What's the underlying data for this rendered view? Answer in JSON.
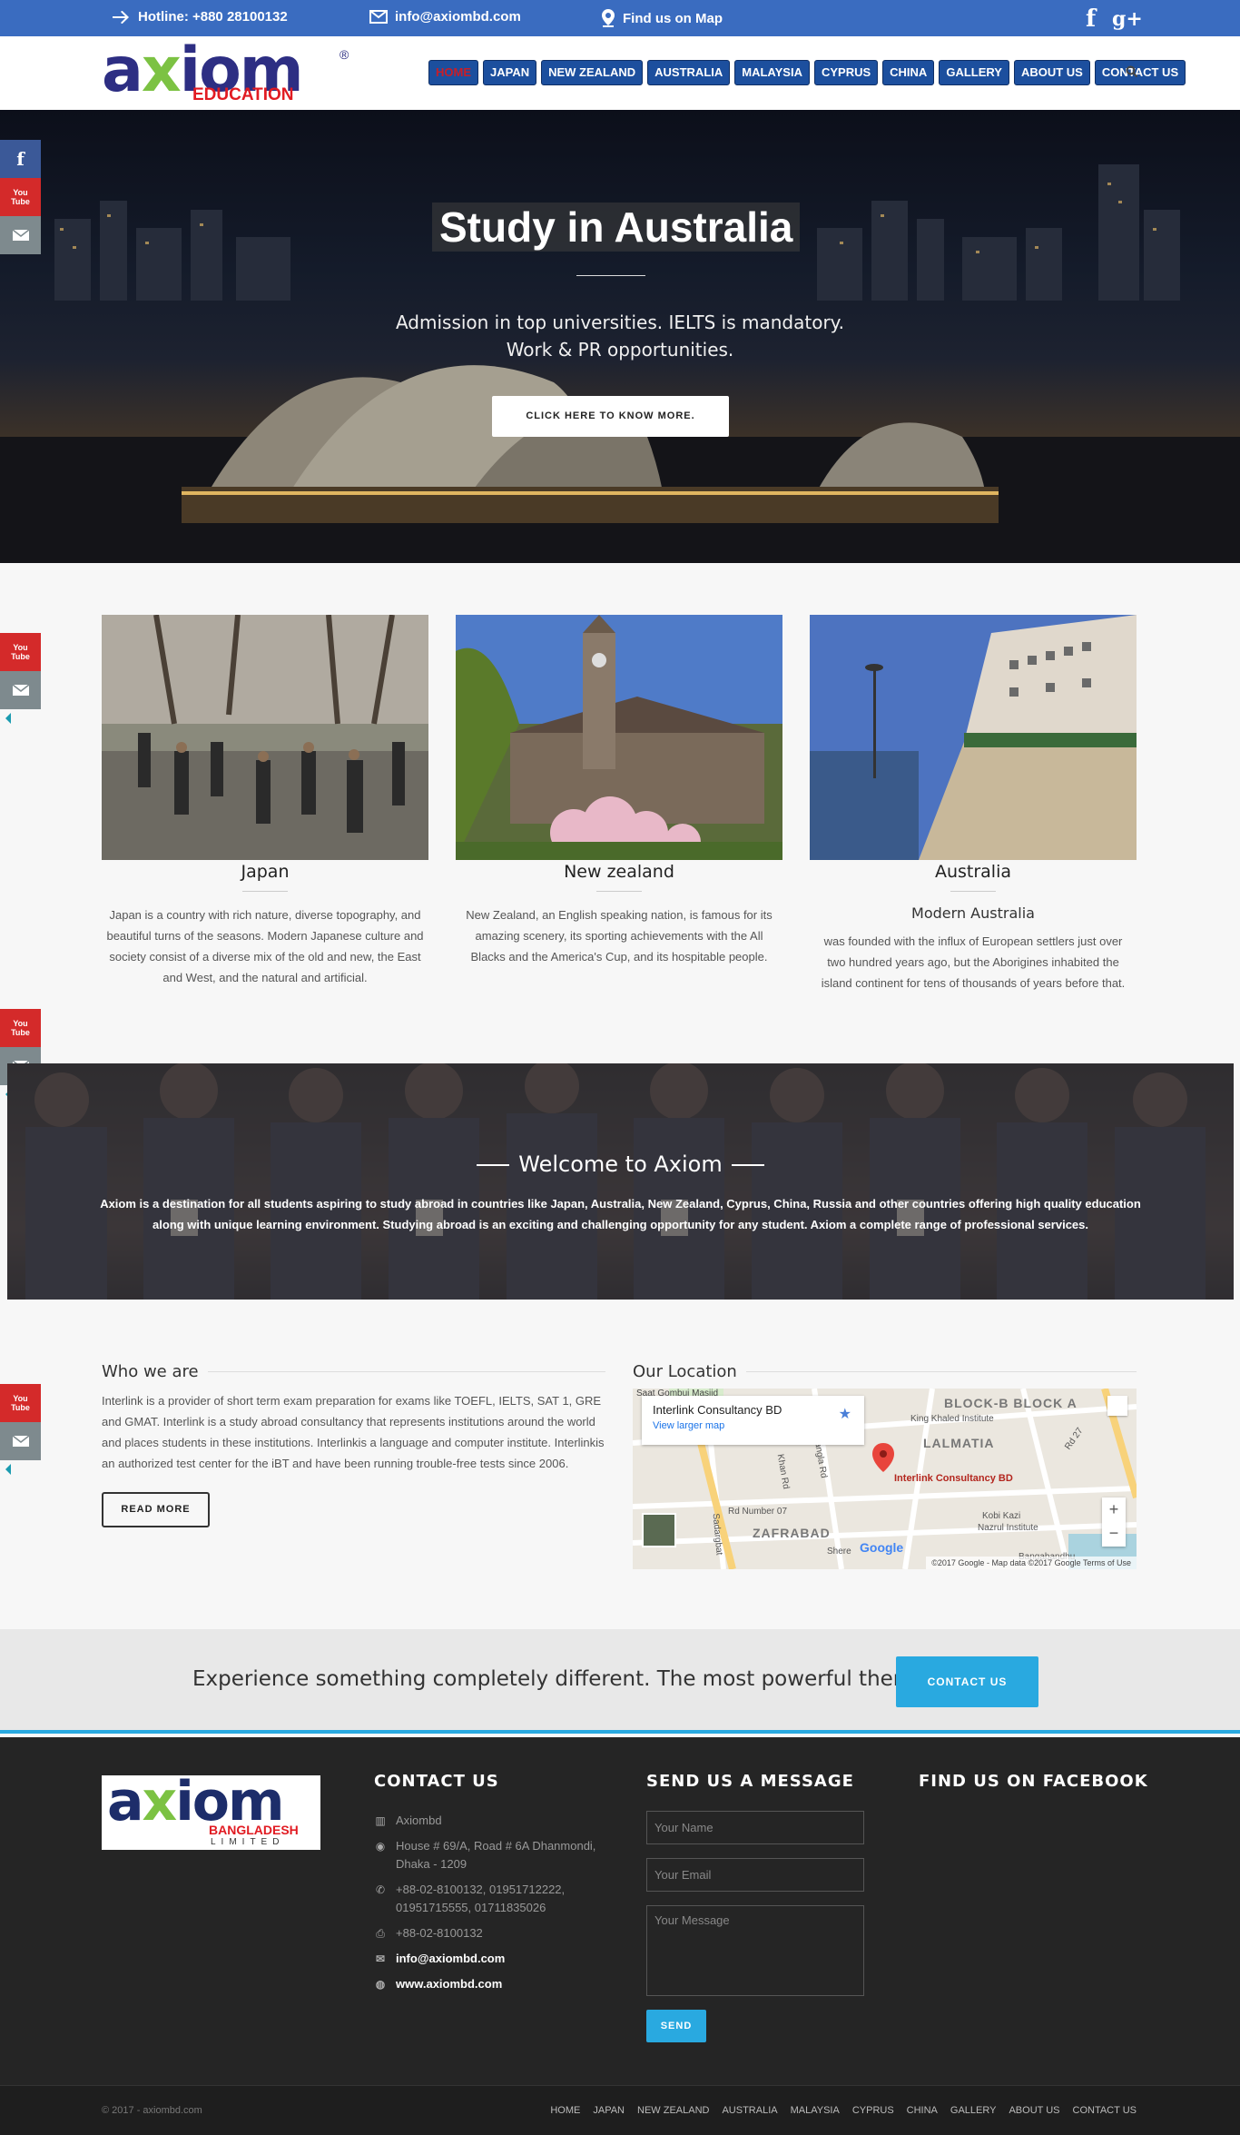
{
  "topbar": {
    "hotline": "Hotline: +880 28100132",
    "email": "info@axiombd.com",
    "map": "Find us on Map",
    "facebook_glyph": "f",
    "gplus_glyph": "g+"
  },
  "logo": {
    "ax1": "a",
    "x": "x",
    "ax2": "iom",
    "reg": "®",
    "education": "EDUCATION"
  },
  "nav": {
    "items": [
      "HOME",
      "JAPAN",
      "NEW ZEALAND",
      "AUSTRALIA",
      "MALAYSIA",
      "CYPRUS",
      "CHINA",
      "GALLERY",
      "ABOUT US",
      "CONTACT US"
    ],
    "active_index": 0
  },
  "share": {
    "facebook": "f",
    "youtube_top": "You",
    "youtube_bottom": "Tube"
  },
  "hero": {
    "title": "Study in Australia",
    "line1": "Admission in top universities. IELTS is mandatory.",
    "line2": "Work & PR opportunities.",
    "cta": "CLICK HERE TO KNOW MORE."
  },
  "cards": [
    {
      "title": "Japan",
      "subtitle": "",
      "text": "Japan is a country with rich nature, diverse topography, and beautiful turns of the seasons. Modern Japanese culture and society consist of a diverse mix of the old and new, the East and West, and the natural and artificial."
    },
    {
      "title": "New zealand",
      "subtitle": "",
      "text": "New Zealand, an English speaking nation, is famous for its amazing scenery, its sporting achievements with the All Blacks and the America's Cup, and its hospitable people."
    },
    {
      "title": "Australia",
      "subtitle": "Modern Australia",
      "text": "was founded with the influx of European settlers just over two hundred years ago, but the Aborigines inhabited the island continent for tens of thousands of years before that."
    }
  ],
  "welcome": {
    "title": "Welcome to Axiom",
    "text": "Axiom is a destination for all students aspiring to study abroad in countries like Japan, Australia, New Zealand, Cyprus, China, Russia and other countries offering high quality education along with unique learning environment. Studying abroad is an exciting and challenging opportunity for any student. Axiom a complete range of professional services."
  },
  "who": {
    "title": "Who we are",
    "text": "Interlink is a provider of short term exam preparation for exams like TOEFL, IELTS, SAT 1, GRE and GMAT. Interlink is a study abroad consultancy that represents institutions around the world and places students in these institutions. Interlinkis a language and computer institute. Interlinkis an authorized test center for the iBT and have been running trouble-free tests since 2006.",
    "button": "READ MORE"
  },
  "location": {
    "title": "Our Location",
    "place": "Interlink Consultancy BD",
    "larger_map": "View larger map",
    "pin_label": "Interlink Consultancy BD",
    "labels": [
      "Saat Gombuj Masjid",
      "BLOCK-B BLOCK A",
      "King Khaled Institute",
      "LALMATIA",
      "Rd Number 07",
      "ZAFRABAD",
      "Kobi Kazi",
      "Nazrul Institute",
      "Bangla Rd",
      "Khan Rd",
      "Rd 27",
      "Sadargbat",
      "Shere",
      "Bangabandhu"
    ],
    "zoom_in": "+",
    "zoom_out": "−",
    "google": "Google",
    "attribution": "©2017 Google - Map data ©2017 Google    Terms of Use"
  },
  "promo": {
    "text": "Experience something completely different. The most powerful theme ever.",
    "button": "CONTACT US"
  },
  "footer": {
    "logo_ax1": "a",
    "logo_x": "x",
    "logo_ax2": "iom",
    "logo_bd": "BANGLADESH",
    "logo_lt": "LIMITED",
    "contact_title": "CONTACT US",
    "message_title": "SEND US A MESSAGE",
    "facebook_title": "FIND US ON FACEBOOK",
    "company": "Axiombd",
    "address": "House # 69/A, Road # 6A Dhanmondi, Dhaka - 1209",
    "phones": "+88-02-8100132, 01951712222, 01951715555, 01711835026",
    "fax": "+88-02-8100132",
    "email": "info@axiombd.com",
    "web": "www.axiombd.com",
    "name_placeholder": "Your Name",
    "email_placeholder": "Your Email",
    "message_placeholder": "Your Message",
    "send": "SEND"
  },
  "bottom": {
    "copyright": "© 2017 - axiombd.com",
    "links": [
      "HOME",
      "JAPAN",
      "NEW ZEALAND",
      "AUSTRALIA",
      "MALAYSIA",
      "CYPRUS",
      "CHINA",
      "GALLERY",
      "ABOUT US",
      "CONTACT US"
    ]
  },
  "colors": {
    "topbar": "#3a6cc0",
    "nav": "#1c4f9e",
    "accent": "#29a9e0",
    "active_nav_text": "#c81e28",
    "footer": "#252525"
  }
}
